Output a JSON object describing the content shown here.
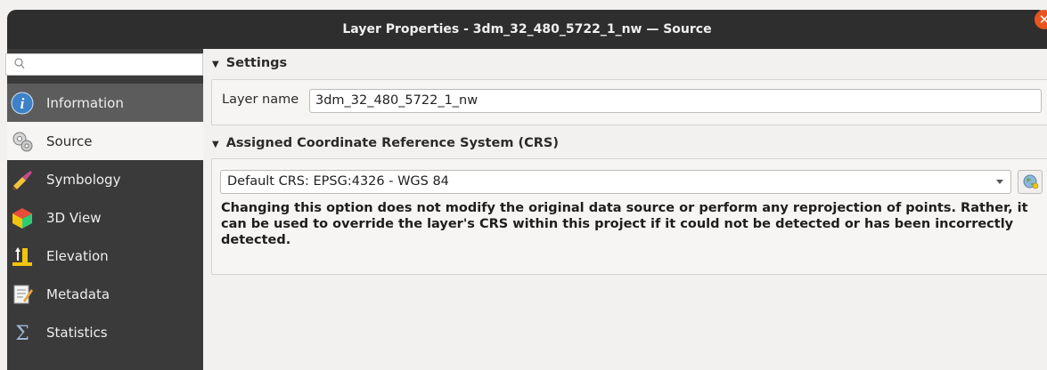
{
  "window": {
    "title": "Layer Properties - 3dm_32_480_5722_1_nw — Source",
    "close_glyph": "✕"
  },
  "search": {
    "placeholder": ""
  },
  "sidebar": {
    "items": [
      {
        "label": "Information",
        "icon": "info-icon"
      },
      {
        "label": "Source",
        "icon": "source-icon"
      },
      {
        "label": "Symbology",
        "icon": "symbology-icon"
      },
      {
        "label": "3D View",
        "icon": "3d-view-icon"
      },
      {
        "label": "Elevation",
        "icon": "elevation-icon"
      },
      {
        "label": "Metadata",
        "icon": "metadata-icon"
      },
      {
        "label": "Statistics",
        "icon": "statistics-icon"
      }
    ],
    "selected": "Source"
  },
  "settings": {
    "title": "Settings",
    "layer_name_label": "Layer name",
    "layer_name_value": "3dm_32_480_5722_1_nw"
  },
  "crs": {
    "title": "Assigned Coordinate Reference System (CRS)",
    "selected": "Default CRS: EPSG:4326 - WGS 84",
    "note": "Changing this option does not modify the original data source or perform any reprojection of points. Rather, it can be used to override the layer's CRS within this project if it could not be detected or has been incorrectly detected."
  },
  "colors": {
    "accent": "#e95420",
    "sidebar_bg": "#3a3a3a",
    "titlebar_bg": "#2e2e2e"
  }
}
